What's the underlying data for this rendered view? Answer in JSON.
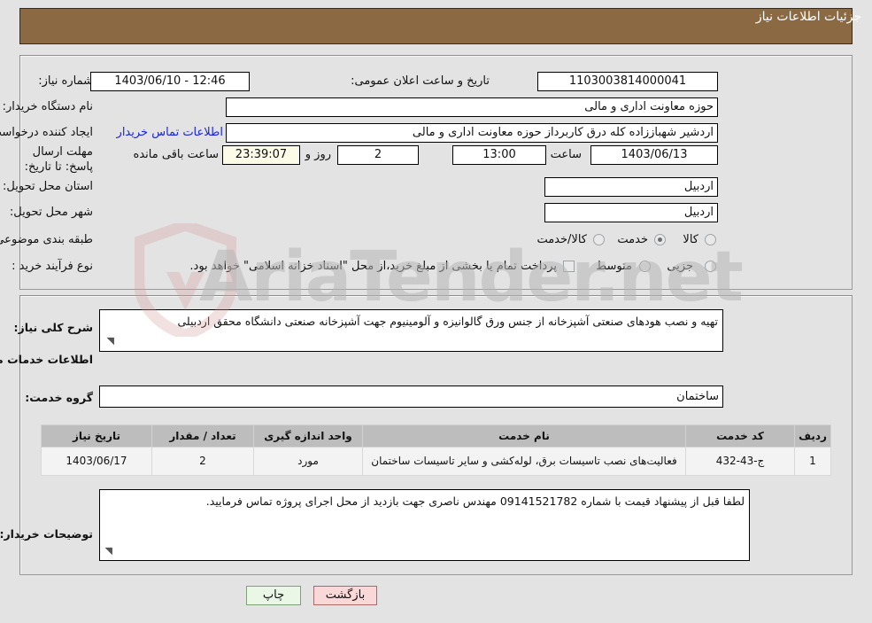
{
  "header": {
    "title": "جزئیات اطلاعات نیاز"
  },
  "form": {
    "need_number_label": "شماره نیاز:",
    "need_number_value": "1103003814000041",
    "announce_datetime_label": "تاریخ و ساعت اعلان عمومی:",
    "announce_datetime_value": "12:46 - 1403/06/10",
    "buyer_org_label": "نام دستگاه خریدار:",
    "buyer_org_value": "حوزه معاونت اداری و مالی",
    "requester_label": "ایجاد کننده درخواست:",
    "requester_value": "اردشیر شهباززاده کله درق کاربرداز حوزه معاونت اداری و مالی",
    "contact_link": "اطلاعات تماس خریدار",
    "deadline_label": "مهلت ارسال پاسخ: تا تاریخ:",
    "deadline_date": "1403/06/13",
    "hour_label": "ساعت",
    "deadline_time": "13:00",
    "days_value": "2",
    "days_label": "روز و",
    "countdown_value": "23:39:07",
    "countdown_label": "ساعت باقی مانده",
    "province_label": "استان محل تحویل:",
    "province_value": "اردبیل",
    "city_label": "شهر محل تحویل:",
    "city_value": "اردبیل",
    "category_label": "طبقه بندی موضوعی:",
    "category_options": [
      {
        "label": "کالا",
        "selected": false
      },
      {
        "label": "خدمت",
        "selected": true
      },
      {
        "label": "کالا/خدمت",
        "selected": false
      }
    ],
    "process_label": "نوع فرآیند خرید :",
    "process_options": [
      {
        "label": "جزیی",
        "selected": false
      },
      {
        "label": "متوسط",
        "selected": false
      }
    ],
    "treasury_checkbox_label": "پرداخت تمام یا بخشی از مبلغ خرید،از محل \"اسناد خزانه اسلامی\" خواهد بود.",
    "treasury_checked": false
  },
  "details": {
    "general_desc_label": "شرح کلی نیاز:",
    "general_desc_value": "تهیه و نصب هودهای صنعتی آشپزخانه از جنس ورق گالوانیزه و آلومینیوم جهت آشپزخانه صنعتی دانشگاه محقق اردبیلی",
    "services_section_title": "اطلاعات خدمات مورد نیاز",
    "service_group_label": "گروه خدمت:",
    "service_group_value": "ساختمان",
    "buyer_notes_label": "توضیحات خریدار:",
    "buyer_notes_value": "لطفا قبل از پیشنهاد قیمت با شماره 09141521782 مهندس ناصری جهت بازدید از محل اجرای پروژه تماس فرمایید."
  },
  "table": {
    "columns": [
      "ردیف",
      "کد خدمت",
      "نام خدمت",
      "واحد اندازه گیری",
      "تعداد / مقدار",
      "تاریخ نیاز"
    ],
    "rows": [
      {
        "index": "1",
        "code": "ج-43-432",
        "name": "فعالیت‌های نصب تاسیسات برق، لوله‌کشی و سایر تاسیسات ساختمان",
        "unit": "مورد",
        "qty": "2",
        "date": "1403/06/17"
      }
    ]
  },
  "buttons": {
    "back": "بازگشت",
    "print": "چاپ"
  },
  "watermark": {
    "text": "AriaTender.net"
  },
  "colors": {
    "header_bar": "#8b6a43",
    "page_bg": "#e3e3e3",
    "link": "#1a24d8",
    "btn_back": "#fbd8d8",
    "btn_print": "#eaf7e6",
    "table_header": "#bdbdbd"
  }
}
